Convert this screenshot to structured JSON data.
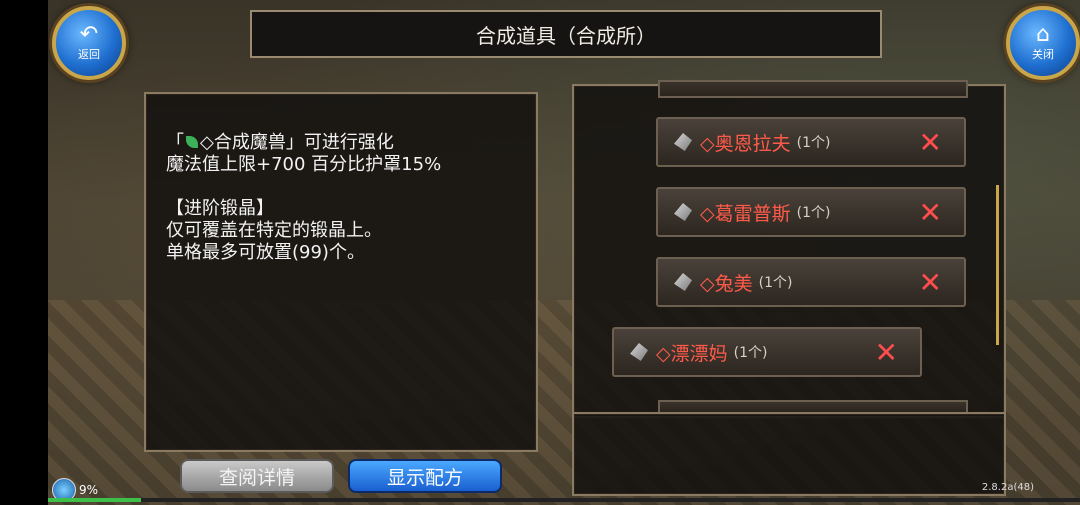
{
  "window": {
    "title": "合成道具（合成所）"
  },
  "nav": {
    "back_label": "返回",
    "close_label": "关闭"
  },
  "description": {
    "lines": [
      "「◇合成魔兽」可进行强化",
      "魔法值上限+700 百分比护罩15%",
      "",
      "【进阶锻晶】",
      "仅可覆盖在特定的锻晶上。",
      "单格最多可放置(99)个。"
    ],
    "bracket_open": "「",
    "line1_rest": "◇合成魔兽」可进行强化",
    "line2": "魔法值上限+700 百分比护罩15%",
    "line4": "【进阶锻晶】",
    "line5": "仅可覆盖在特定的锻晶上。",
    "line6": "单格最多可放置(99)个。"
  },
  "list": {
    "items": [
      {
        "name": "◇奥恩拉夫",
        "count": "(1个)"
      },
      {
        "name": "◇葛雷普斯",
        "count": "(1个)"
      },
      {
        "name": "◇兔美",
        "count": "(1个)"
      },
      {
        "name": "◇漂漂妈",
        "count": "(1个)"
      }
    ],
    "remove_icon": "close-x-icon"
  },
  "buttons": {
    "details_label": "查阅详情",
    "recipe_label": "显示配方"
  },
  "status": {
    "exp_percent": "9%",
    "exp_fraction": 0.09,
    "version": "2.8.2a(48)"
  },
  "colors": {
    "item_text": "#ff5a4a",
    "accent_blue": "#1f6fd0",
    "gold": "#c9a64a"
  }
}
